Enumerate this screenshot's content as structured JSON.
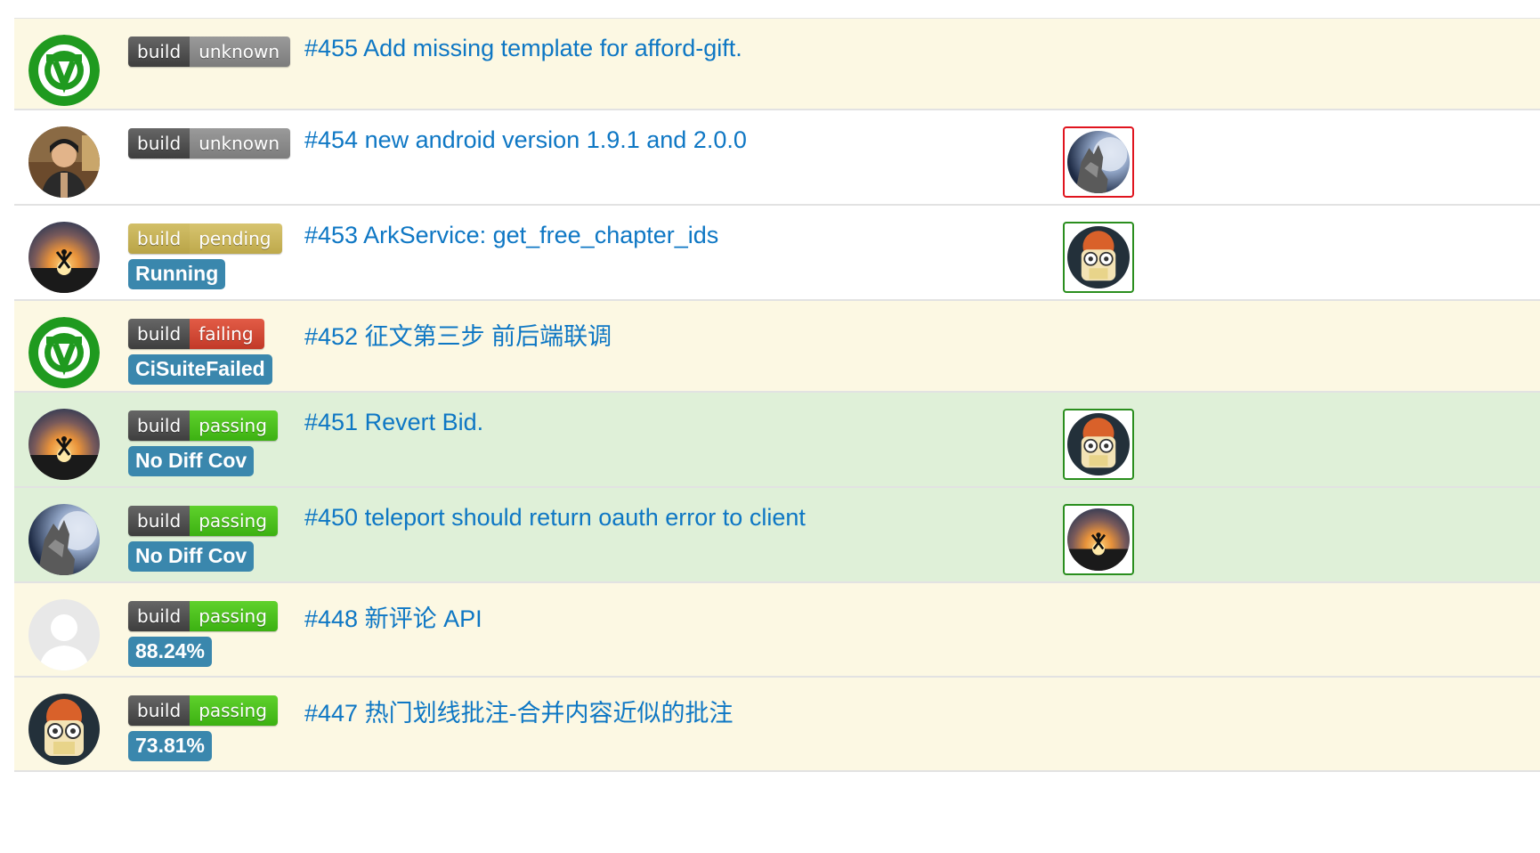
{
  "pull_requests": [
    {
      "number_title": "#455 Add missing template for afford-gift.",
      "author_icon": "green-w-logo-icon",
      "build_left": "build",
      "build_right": "unknown",
      "build_status": "unknown",
      "label": null,
      "reviewer_icon": null,
      "review_state": null,
      "row_color": "#fcf8e3"
    },
    {
      "number_title": "#454 new android version 1.9.1 and 2.0.0",
      "author_icon": "person-photo-icon",
      "build_left": "build",
      "build_right": "unknown",
      "build_status": "unknown",
      "label": null,
      "reviewer_icon": "wolf-moon-icon",
      "review_state": "changes-requested",
      "row_color": "#ffffff"
    },
    {
      "number_title": "#453 ArkService: get_free_chapter_ids",
      "author_icon": "sunset-jump-icon",
      "build_left": "build",
      "build_right": "pending",
      "build_status": "pending",
      "label": "Running",
      "reviewer_icon": "robot-face-icon",
      "review_state": "approved",
      "row_color": "#ffffff"
    },
    {
      "number_title": "#452 征文第三步 前后端联调",
      "author_icon": "green-w-logo-icon",
      "build_left": "build",
      "build_right": "failing",
      "build_status": "failing",
      "label": "CiSuiteFailed",
      "reviewer_icon": null,
      "review_state": null,
      "row_color": "#fcf8e3"
    },
    {
      "number_title": "#451 Revert Bid.",
      "author_icon": "sunset-jump-icon",
      "build_left": "build",
      "build_right": "passing",
      "build_status": "passing",
      "label": "No Diff Cov",
      "reviewer_icon": "robot-face-icon",
      "review_state": "approved",
      "row_color": "#dff0d8"
    },
    {
      "number_title": "#450 teleport should return oauth error to client",
      "author_icon": "wolf-moon-icon",
      "build_left": "build",
      "build_right": "passing",
      "build_status": "passing",
      "label": "No Diff Cov",
      "reviewer_icon": "sunset-jump-icon",
      "review_state": "approved",
      "row_color": "#dff0d8"
    },
    {
      "number_title": "#448 新评论 API",
      "author_icon": "default-avatar-icon",
      "build_left": "build",
      "build_right": "passing",
      "build_status": "passing",
      "label": "88.24%",
      "reviewer_icon": null,
      "review_state": null,
      "row_color": "#fcf8e3"
    },
    {
      "number_title": "#447 热门划线批注-合并内容近似的批注",
      "author_icon": "robot-face-icon",
      "build_left": "build",
      "build_right": "passing",
      "build_status": "passing",
      "label": "73.81%",
      "reviewer_icon": null,
      "review_state": null,
      "row_color": "#fcf8e3"
    }
  ],
  "colors": {
    "link": "#0e77c4",
    "label_bg": "#3a87ad",
    "row_pending": "#fcf8e3",
    "row_passing": "#dff0d8",
    "review_changes": "#e0141e",
    "review_approved": "#2a8e1e"
  }
}
